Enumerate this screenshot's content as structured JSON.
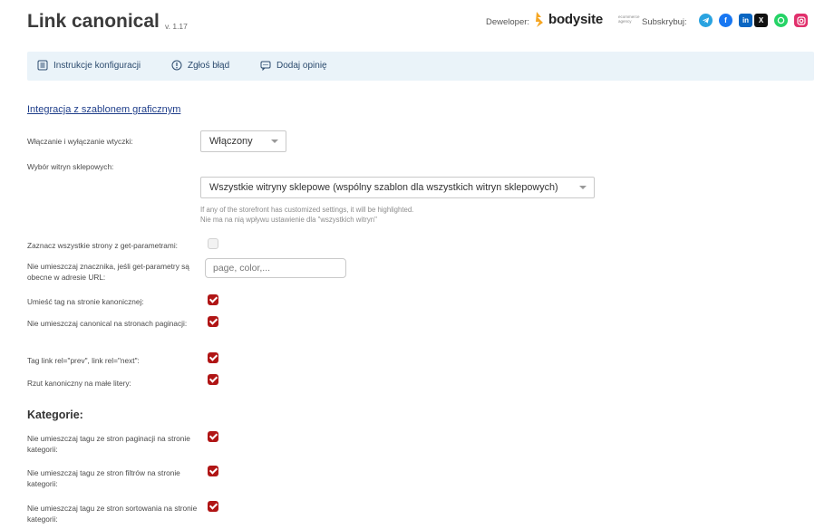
{
  "header": {
    "title": "Link canonical",
    "version": "v. 1.17",
    "developer_label": "Deweloper:",
    "brand_name": "bodysite",
    "brand_tagline": "ecommerce agency",
    "subscribe_label": "Subskrybuj:",
    "socials": [
      {
        "name": "telegram",
        "color": "#2aa3e0"
      },
      {
        "name": "facebook",
        "color": "#1877f2"
      },
      {
        "name": "linkedin",
        "color": "#0a66c2"
      },
      {
        "name": "x",
        "color": "#111111"
      },
      {
        "name": "whatsapp",
        "color": "#25d366"
      },
      {
        "name": "instagram",
        "color": "#e1306c"
      }
    ]
  },
  "toolbar": {
    "config_label": "Instrukcje konfiguracji",
    "report_label": "Zgłoś błąd",
    "review_label": "Dodaj opinię"
  },
  "section": {
    "link": "Integracja z szablonem graficznym"
  },
  "settings": {
    "enable_label": "Włączanie i wyłączanie wtyczki:",
    "enable_value": "Włączony",
    "storefront_label": "Wybór witryn sklepowych:",
    "storefront_value": "Wszystkie witryny sklepowe (wspólny szablon dla wszystkich witryn sklepowych)",
    "storefront_hint_1": "If any of the storefront has customized settings, it will be highlighted.",
    "storefront_hint_2": "Nie ma na nią wpływu ustawienie dla \"wszystkich witryn\"",
    "get_all_label": "Zaznacz wszystkie strony z get-parametrami:",
    "get_all_checked": false,
    "exclude_get_label": "Nie umieszczaj znacznika, jeśli get-parametry są obecne w adresie URL:",
    "exclude_get_placeholder": "page, color,...",
    "canonical_tag_label": "Umieść tag na stronie kanonicznej:",
    "canonical_tag_checked": true,
    "no_canonical_pagination_label": "Nie umieszczaj canonical na stronach paginacji:",
    "no_canonical_pagination_checked": true,
    "rel_prev_next_label": "Tag link rel=\"prev\", link rel=\"next\":",
    "rel_prev_next_checked": true,
    "lowercase_label": "Rzut kanoniczny na małe litery:",
    "lowercase_checked": true
  },
  "categories": {
    "heading": "Kategorie:",
    "pagination_label": "Nie umieszczaj tagu ze stron paginacji na stronie kategorii:",
    "pagination_checked": true,
    "filters_label": "Nie umieszczaj tagu ze stron filtrów na stronie kategorii:",
    "filters_checked": true,
    "sorting_label": "Nie umieszczaj tagu ze stron sortowania na stronie kategorii:",
    "sorting_checked": true
  },
  "colors": {
    "accent_checkbox": "#b01515",
    "toolbar_bg": "#eaf3f9",
    "link": "#1f3e8a",
    "brand_orange": "#f5a623"
  }
}
